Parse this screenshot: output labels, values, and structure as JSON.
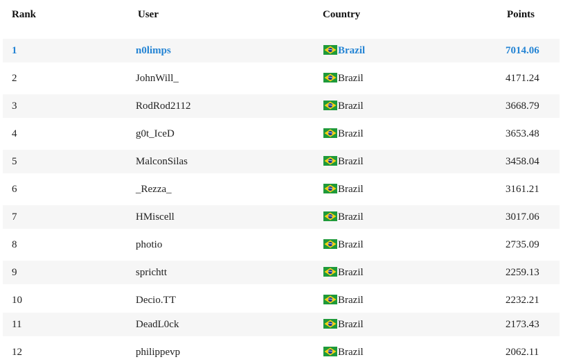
{
  "headers": {
    "rank": "Rank",
    "user": "User",
    "country": "Country",
    "points": "Points"
  },
  "rows": [
    {
      "rank": "1",
      "user": "n0limps",
      "country": "Brazil",
      "points": "7014.06"
    },
    {
      "rank": "2",
      "user": "JohnWill_",
      "country": "Brazil",
      "points": "4171.24"
    },
    {
      "rank": "3",
      "user": "RodRod2112",
      "country": "Brazil",
      "points": "3668.79"
    },
    {
      "rank": "4",
      "user": "g0t_IceD",
      "country": "Brazil",
      "points": "3653.48"
    },
    {
      "rank": "5",
      "user": "MalconSilas",
      "country": "Brazil",
      "points": "3458.04"
    },
    {
      "rank": "6",
      "user": "_Rezza_",
      "country": "Brazil",
      "points": "3161.21"
    },
    {
      "rank": "7",
      "user": "HMiscell",
      "country": "Brazil",
      "points": "3017.06"
    },
    {
      "rank": "8",
      "user": "photio",
      "country": "Brazil",
      "points": "2735.09"
    },
    {
      "rank": "9",
      "user": "sprichtt",
      "country": "Brazil",
      "points": "2259.13"
    },
    {
      "rank": "10",
      "user": "Decio.TT",
      "country": "Brazil",
      "points": "2232.21"
    },
    {
      "rank": "11",
      "user": "DeadL0ck",
      "country": "Brazil",
      "points": "2173.43"
    },
    {
      "rank": "12",
      "user": "philippevp",
      "country": "Brazil",
      "points": "2062.11"
    }
  ],
  "flag_icon": "brazil-flag-icon",
  "colors": {
    "highlight": "#2484d4",
    "row_stripe": "#f6f6f6",
    "flag_green": "#1f9a3a",
    "flag_yellow": "#f7d117",
    "flag_blue": "#1b3f8f"
  }
}
